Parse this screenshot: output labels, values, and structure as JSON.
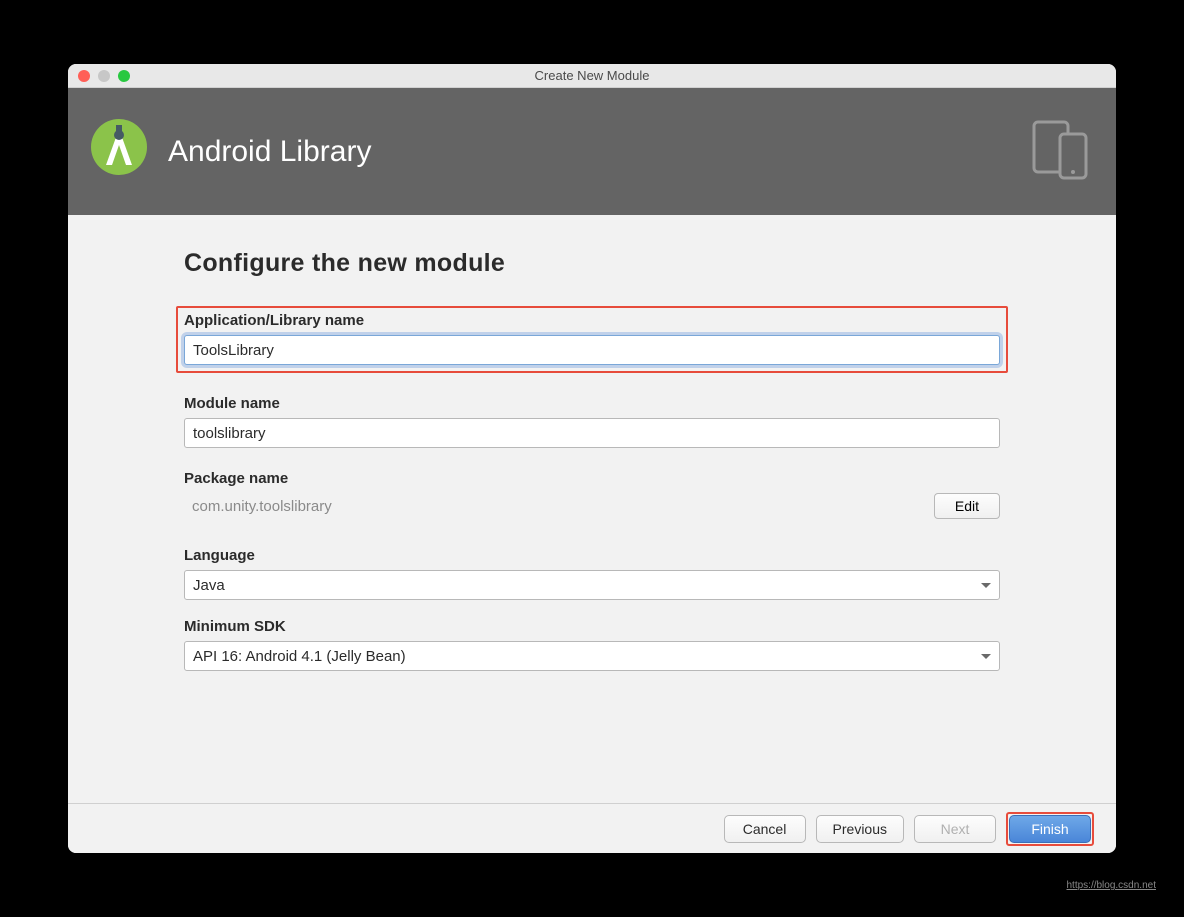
{
  "window": {
    "title": "Create New Module"
  },
  "banner": {
    "title": "Android Library"
  },
  "form": {
    "heading": "Configure the new module",
    "app_name_label": "Application/Library name",
    "app_name_value": "ToolsLibrary",
    "module_name_label": "Module name",
    "module_name_value": "toolslibrary",
    "package_name_label": "Package name",
    "package_name_value": "com.unity.toolslibrary",
    "edit_label": "Edit",
    "language_label": "Language",
    "language_value": "Java",
    "min_sdk_label": "Minimum SDK",
    "min_sdk_value": "API 16: Android 4.1 (Jelly Bean)"
  },
  "footer": {
    "cancel": "Cancel",
    "previous": "Previous",
    "next": "Next",
    "finish": "Finish"
  },
  "watermark": "https://blog.csdn.net"
}
